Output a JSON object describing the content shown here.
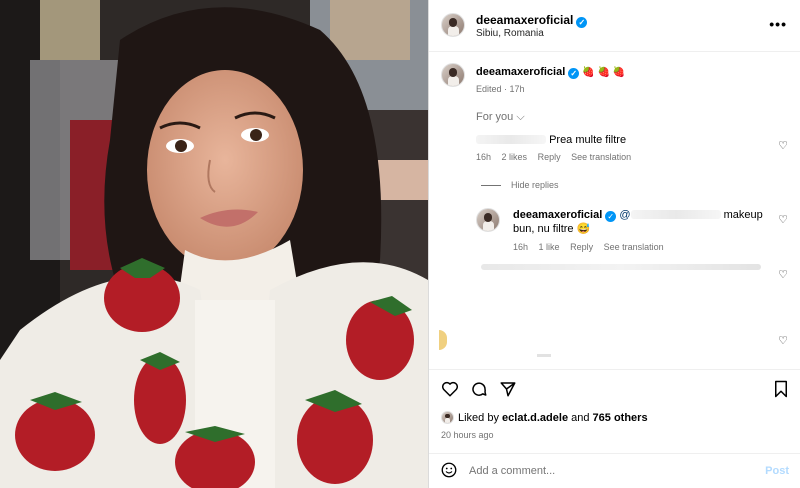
{
  "header": {
    "username": "deeamaxeroficial",
    "location": "Sibiu, Romania",
    "more_label": "•••"
  },
  "caption": {
    "username": "deeamaxeroficial",
    "emojis": "🍓 🍓 🍓",
    "meta": "Edited · 17h"
  },
  "filter": {
    "label": "For you ⌵"
  },
  "comments": [
    {
      "text": "Prea multe filtre",
      "time": "16h",
      "likes": "2 likes",
      "reply": "Reply",
      "translate": "See translation"
    }
  ],
  "hide_replies": "Hide replies",
  "reply": {
    "username": "deeamaxeroficial",
    "mention": "@",
    "text": "makeup bun, nu filtre 😅",
    "time": "16h",
    "likes": "1 like",
    "reply": "Reply",
    "translate": "See translation"
  },
  "likes": {
    "prefix": "Liked by ",
    "user": "eclat.d.adele",
    "middle": " and ",
    "count": "765 others"
  },
  "timestamp": "20 hours ago",
  "composer": {
    "placeholder": "Add a comment...",
    "post_label": "Post"
  },
  "colors": {
    "accent": "#0095f6",
    "muted": "#737373",
    "post_disabled": "#b3dbff"
  }
}
